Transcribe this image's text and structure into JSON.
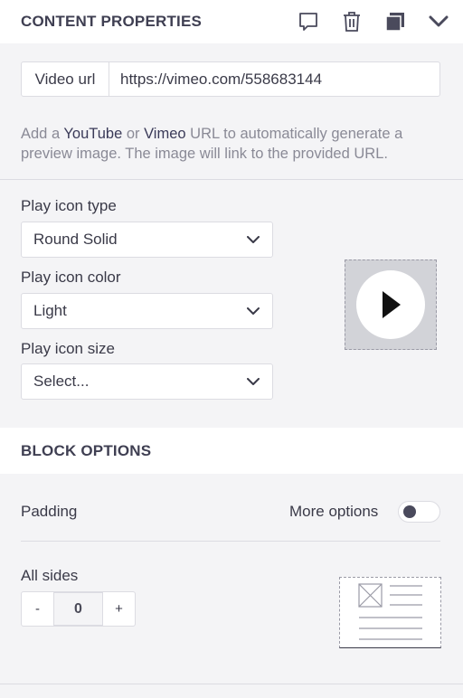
{
  "header": {
    "title": "CONTENT PROPERTIES",
    "icons": [
      "comment-icon",
      "trash-icon",
      "duplicate-icon",
      "chevron-down-icon"
    ]
  },
  "video": {
    "label": "Video url",
    "value": "https://vimeo.com/558683144"
  },
  "help": {
    "prefix": "Add a ",
    "youtube": "YouTube",
    "or": " or ",
    "vimeo": "Vimeo",
    "suffix": " URL to automatically generate a preview image. The image will link to the provided URL."
  },
  "play_icon": {
    "type_label": "Play icon type",
    "type_value": "Round Solid",
    "color_label": "Play icon color",
    "color_value": "Light",
    "size_label": "Play icon size",
    "size_value": "Select..."
  },
  "block_options": {
    "title": "BLOCK OPTIONS",
    "padding_label": "Padding",
    "more_options_label": "More options",
    "more_options_on": false,
    "all_sides_label": "All sides",
    "minus_label": "-",
    "value": "0",
    "plus_label": "+"
  },
  "colors": {
    "panel_bg": "#f4f4f6",
    "text": "#3a3a48",
    "muted": "#8a8a96",
    "border": "#dcdce2"
  }
}
